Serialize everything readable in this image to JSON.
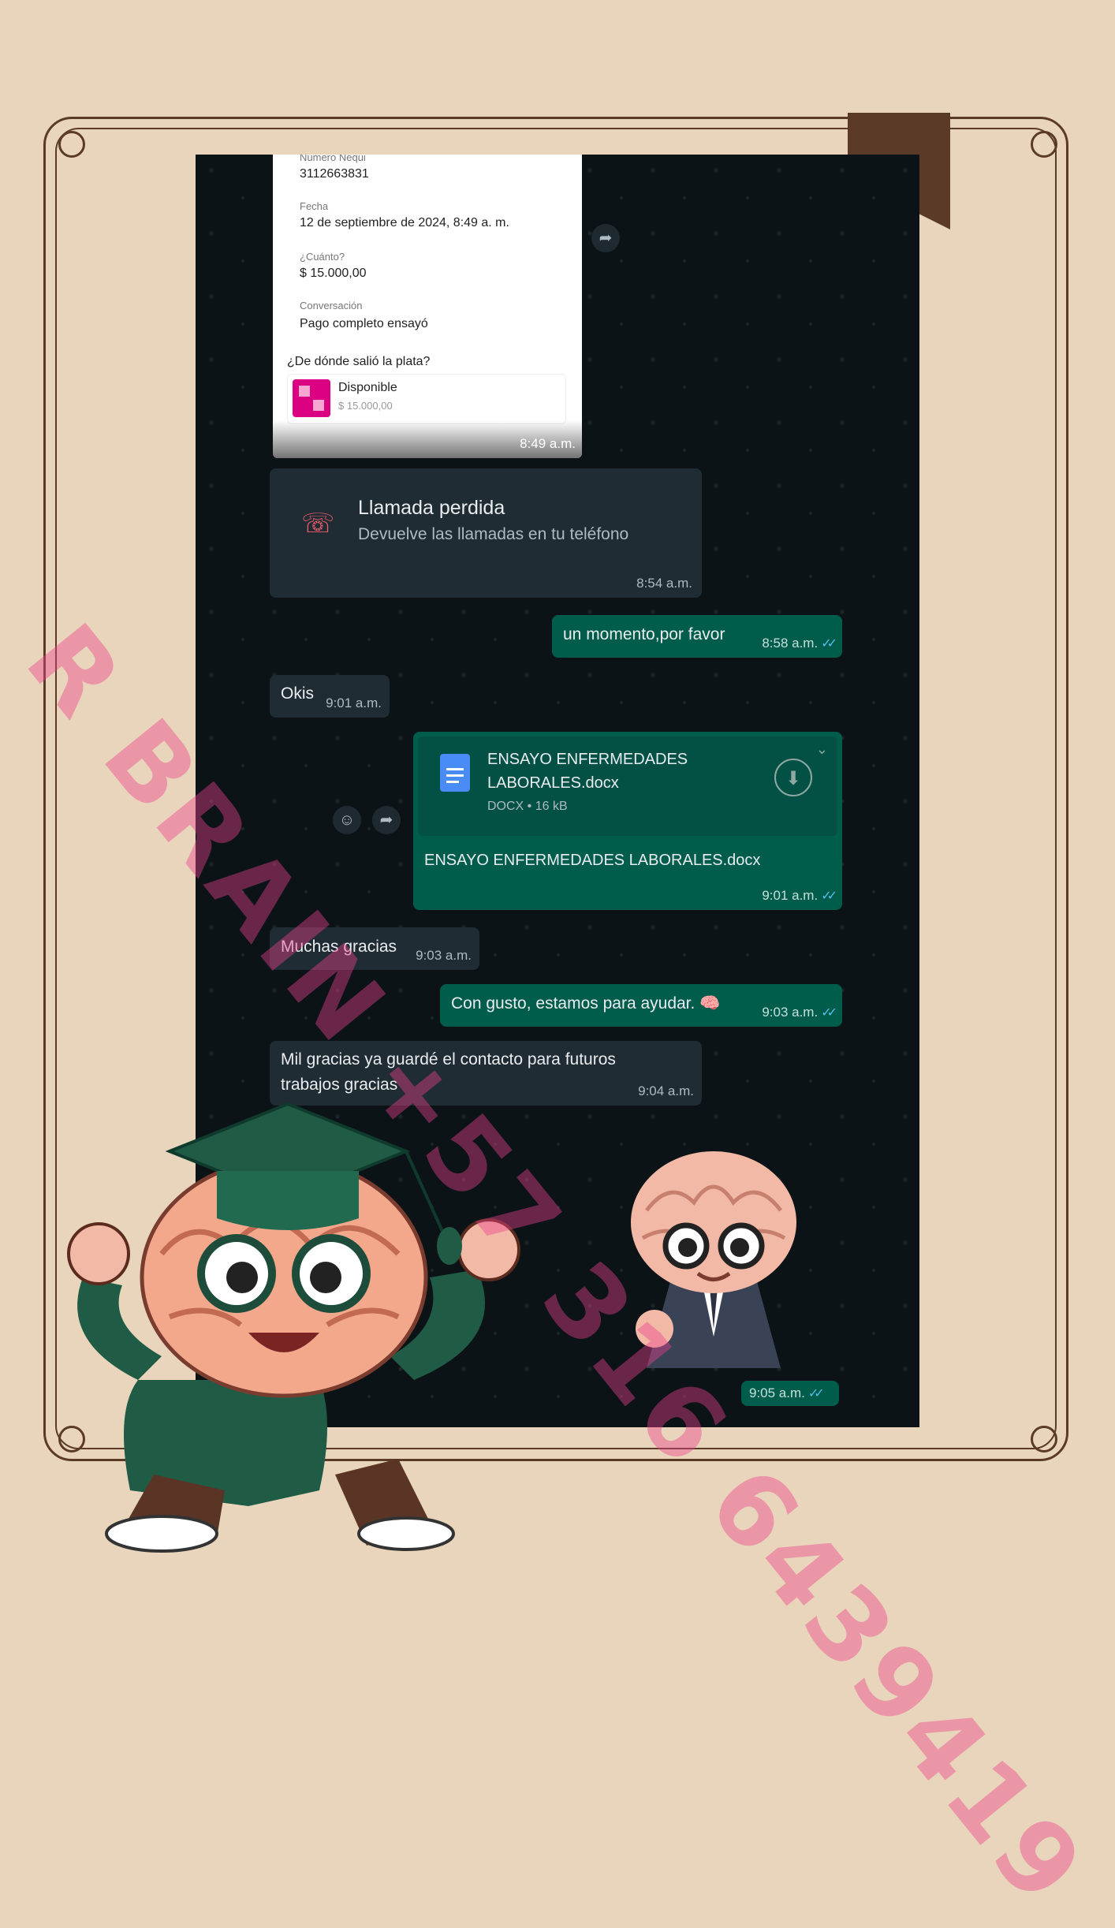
{
  "receipt": {
    "numero_label": "Número Nequi",
    "numero_value": "3112663831",
    "fecha_label": "Fecha",
    "fecha_value": "12 de septiembre de 2024, 8:49 a. m.",
    "cuanto_label": "¿Cuánto?",
    "cuanto_value": "$ 15.000,00",
    "conversacion_label": "Conversación",
    "conversacion_value": "Pago completo ensayó",
    "origen_label": "¿De dónde salió la plata?",
    "origen_name": "Disponible",
    "origen_amount": "$ 15.000,00",
    "time": "8:49 a.m."
  },
  "missed_call": {
    "title": "Llamada perdida",
    "subtitle": "Devuelve las llamadas en tu teléfono",
    "time": "8:54 a.m."
  },
  "messages": {
    "m1": {
      "text": "un momento,por favor",
      "time": "8:58 a.m."
    },
    "m2": {
      "text": "Okis",
      "time": "9:01 a.m."
    },
    "m3": {
      "text": "Muchas gracias",
      "time": "9:03 a.m."
    },
    "m4": {
      "text": "Con gusto, estamos para ayudar. 🧠",
      "time": "9:03 a.m."
    },
    "m5": {
      "line1": "Mil gracias ya guardé el contacto para futuros",
      "line2": "trabajos gracias",
      "time": "9:04 a.m."
    },
    "sticker_time": "9:05 a.m."
  },
  "document": {
    "name_line1": "ENSAYO ENFERMEDADES",
    "name_line2": "LABORALES.docx",
    "meta": "DOCX • 16 kB",
    "caption": "ENSAYO ENFERMEDADES LABORALES.docx",
    "time": "9:01 a.m."
  },
  "watermark": "R BRAIN +57 316 6439419",
  "colors": {
    "background": "#e9d5bb",
    "frame": "#5b3b28",
    "chat_bg": "#0c1317",
    "in_bubble": "#202c33",
    "out_bubble": "#005c4b",
    "watermark": "#ec408c"
  }
}
